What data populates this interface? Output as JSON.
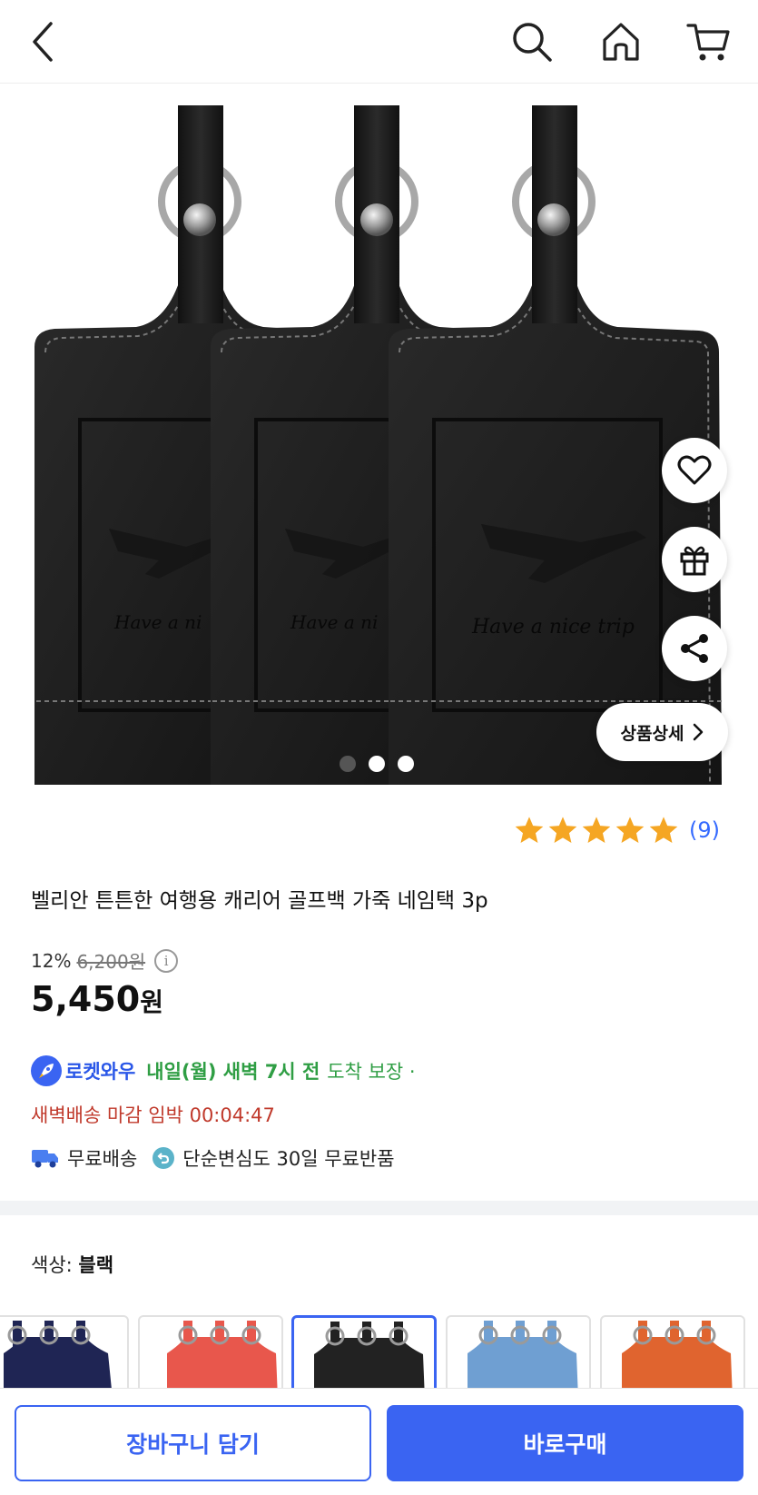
{
  "header": {
    "icons": [
      "chevron-left-icon",
      "search-icon",
      "home-icon",
      "cart-icon"
    ]
  },
  "gallery": {
    "image_text": "Have a nice trip",
    "page_count": 3,
    "current_page": 1,
    "detail_button_label": "상품상세",
    "side_actions": [
      "heart-icon",
      "gift-icon",
      "share-icon"
    ]
  },
  "product": {
    "rating_count": "(9)",
    "rating_stars": 5,
    "title": "벨리안 튼튼한 여행용 캐리어 골프백 가죽 네임택 3p",
    "discount_rate": "12%",
    "original_price": "6,200원",
    "price_number": "5,450",
    "price_unit": "원"
  },
  "delivery": {
    "brand": "로켓와우",
    "arrival_bold": "내일(월) 새벽 7시 전",
    "arrival_rest": "도착 보장 ·",
    "deadline": "새벽배송 마감 임박 00:04:47",
    "free_shipping": "무료배송",
    "free_return": "단순변심도 30일 무료반품"
  },
  "options": {
    "color_label": "색상:",
    "color_value": "블랙",
    "swatch_colors": [
      "#1f2554",
      "#e8574c",
      "#222222",
      "#6f9fd2",
      "#e0642f"
    ],
    "selected_index": 2
  },
  "actions": {
    "add_to_cart": "장바구니 담기",
    "buy_now": "바로구매"
  },
  "colors": {
    "accent": "#3a64f2",
    "link": "#346aff",
    "star": "#f5a623",
    "green": "#2f9e44",
    "red": "#c0392b"
  }
}
